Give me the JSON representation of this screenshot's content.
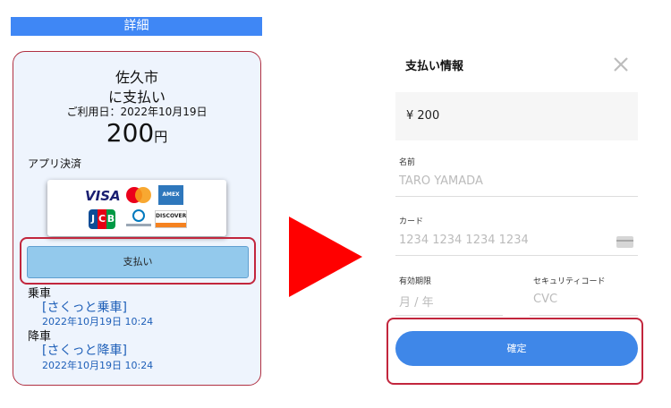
{
  "left_panel": {
    "header": "詳細",
    "merchant_line1": "佐久市",
    "merchant_line2": "に支払い",
    "usage_date": "ご利用日：2022年10月19日",
    "amount_value": "200",
    "amount_unit": "円",
    "payment_method_label": "アプリ決済",
    "card_brands": {
      "visa": "VISA",
      "amex": "AMERICAN EXPRESS",
      "jcb": [
        "J",
        "C",
        "B"
      ],
      "discover": "DISCOVER"
    },
    "pay_button": "支払い",
    "boarding": {
      "label": "乗車",
      "link": "[さくっと乗車]",
      "time": "2022年10月19日 10:24"
    },
    "alighting": {
      "label": "降車",
      "link": "[さくっと降車]",
      "time": "2022年10月19日 10:24"
    }
  },
  "right_panel": {
    "title": "支払い情報",
    "amount": "¥ 200",
    "name": {
      "label": "名前",
      "value": "TARO YAMADA"
    },
    "card": {
      "label": "カード",
      "value": "1234 1234 1234 1234"
    },
    "expiry": {
      "label": "有効期限",
      "value": "月 / 年"
    },
    "cvc": {
      "label": "セキュリティコード",
      "value": "CVC"
    },
    "confirm_button": "確定"
  },
  "colors": {
    "header_blue": "#3f87f5",
    "highlight_red": "#c2263d",
    "arrow_red": "#ff0000",
    "confirm_blue": "#3f87e8",
    "link_blue": "#1e5fb8"
  }
}
